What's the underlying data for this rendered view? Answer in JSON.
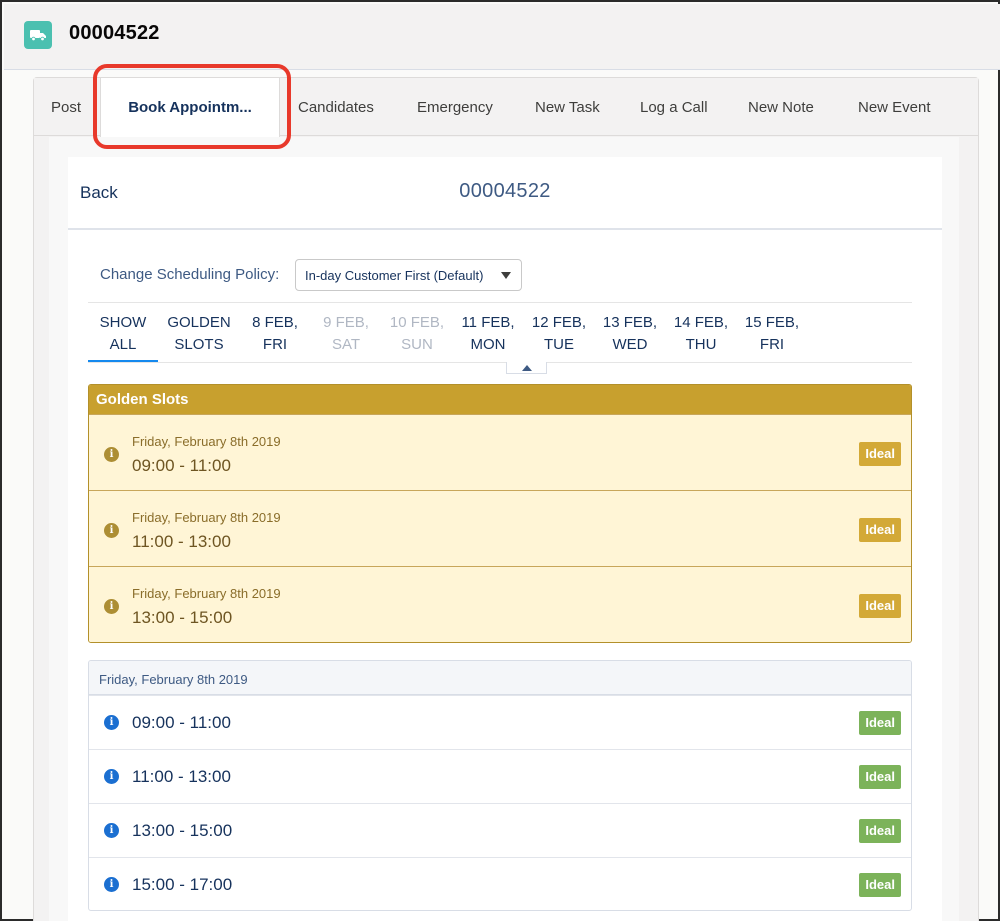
{
  "record": {
    "title": "00004522",
    "icon": "truck-icon",
    "icon_color": "#4bc0b0"
  },
  "action_tabs": [
    {
      "label": "Post",
      "active": false
    },
    {
      "label": "Book Appointm...",
      "active": true
    },
    {
      "label": "Candidates",
      "active": false
    },
    {
      "label": "Emergency",
      "active": false
    },
    {
      "label": "New Task",
      "active": false
    },
    {
      "label": "Log a Call",
      "active": false
    },
    {
      "label": "New Note",
      "active": false
    },
    {
      "label": "New Event",
      "active": false
    }
  ],
  "panel": {
    "back_label": "Back",
    "title": "00004522"
  },
  "policy": {
    "label": "Change Scheduling Policy:",
    "selected": "In-day Customer First (Default)"
  },
  "date_tabs": [
    {
      "line1": "SHOW",
      "line2": "ALL",
      "state": "active"
    },
    {
      "line1": "GOLDEN",
      "line2": "SLOTS",
      "state": "enabled"
    },
    {
      "line1": "8 FEB,",
      "line2": "FRI",
      "state": "enabled"
    },
    {
      "line1": "9 FEB,",
      "line2": "SAT",
      "state": "disabled"
    },
    {
      "line1": "10 FEB,",
      "line2": "SUN",
      "state": "disabled"
    },
    {
      "line1": "11 FEB,",
      "line2": "MON",
      "state": "enabled"
    },
    {
      "line1": "12 FEB,",
      "line2": "TUE",
      "state": "enabled"
    },
    {
      "line1": "13 FEB,",
      "line2": "WED",
      "state": "enabled"
    },
    {
      "line1": "14 FEB,",
      "line2": "THU",
      "state": "enabled"
    },
    {
      "line1": "15 FEB,",
      "line2": "FRI",
      "state": "enabled"
    }
  ],
  "golden_slots": {
    "heading": "Golden Slots",
    "color": "#c8a02e",
    "slots": [
      {
        "date": "Friday, February 8th 2019",
        "time": "09:00 - 11:00",
        "badge": "Ideal"
      },
      {
        "date": "Friday, February 8th 2019",
        "time": "11:00 - 13:00",
        "badge": "Ideal"
      },
      {
        "date": "Friday, February 8th 2019",
        "time": "13:00 - 15:00",
        "badge": "Ideal"
      }
    ]
  },
  "day_group": {
    "heading": "Friday, February 8th 2019",
    "badge_color": "#7cb35a",
    "slots": [
      {
        "time": "09:00 - 11:00",
        "badge": "Ideal"
      },
      {
        "time": "11:00 - 13:00",
        "badge": "Ideal"
      },
      {
        "time": "13:00 - 15:00",
        "badge": "Ideal"
      },
      {
        "time": "15:00 - 17:00",
        "badge": "Ideal"
      }
    ]
  },
  "info_icon_glyph": "i"
}
